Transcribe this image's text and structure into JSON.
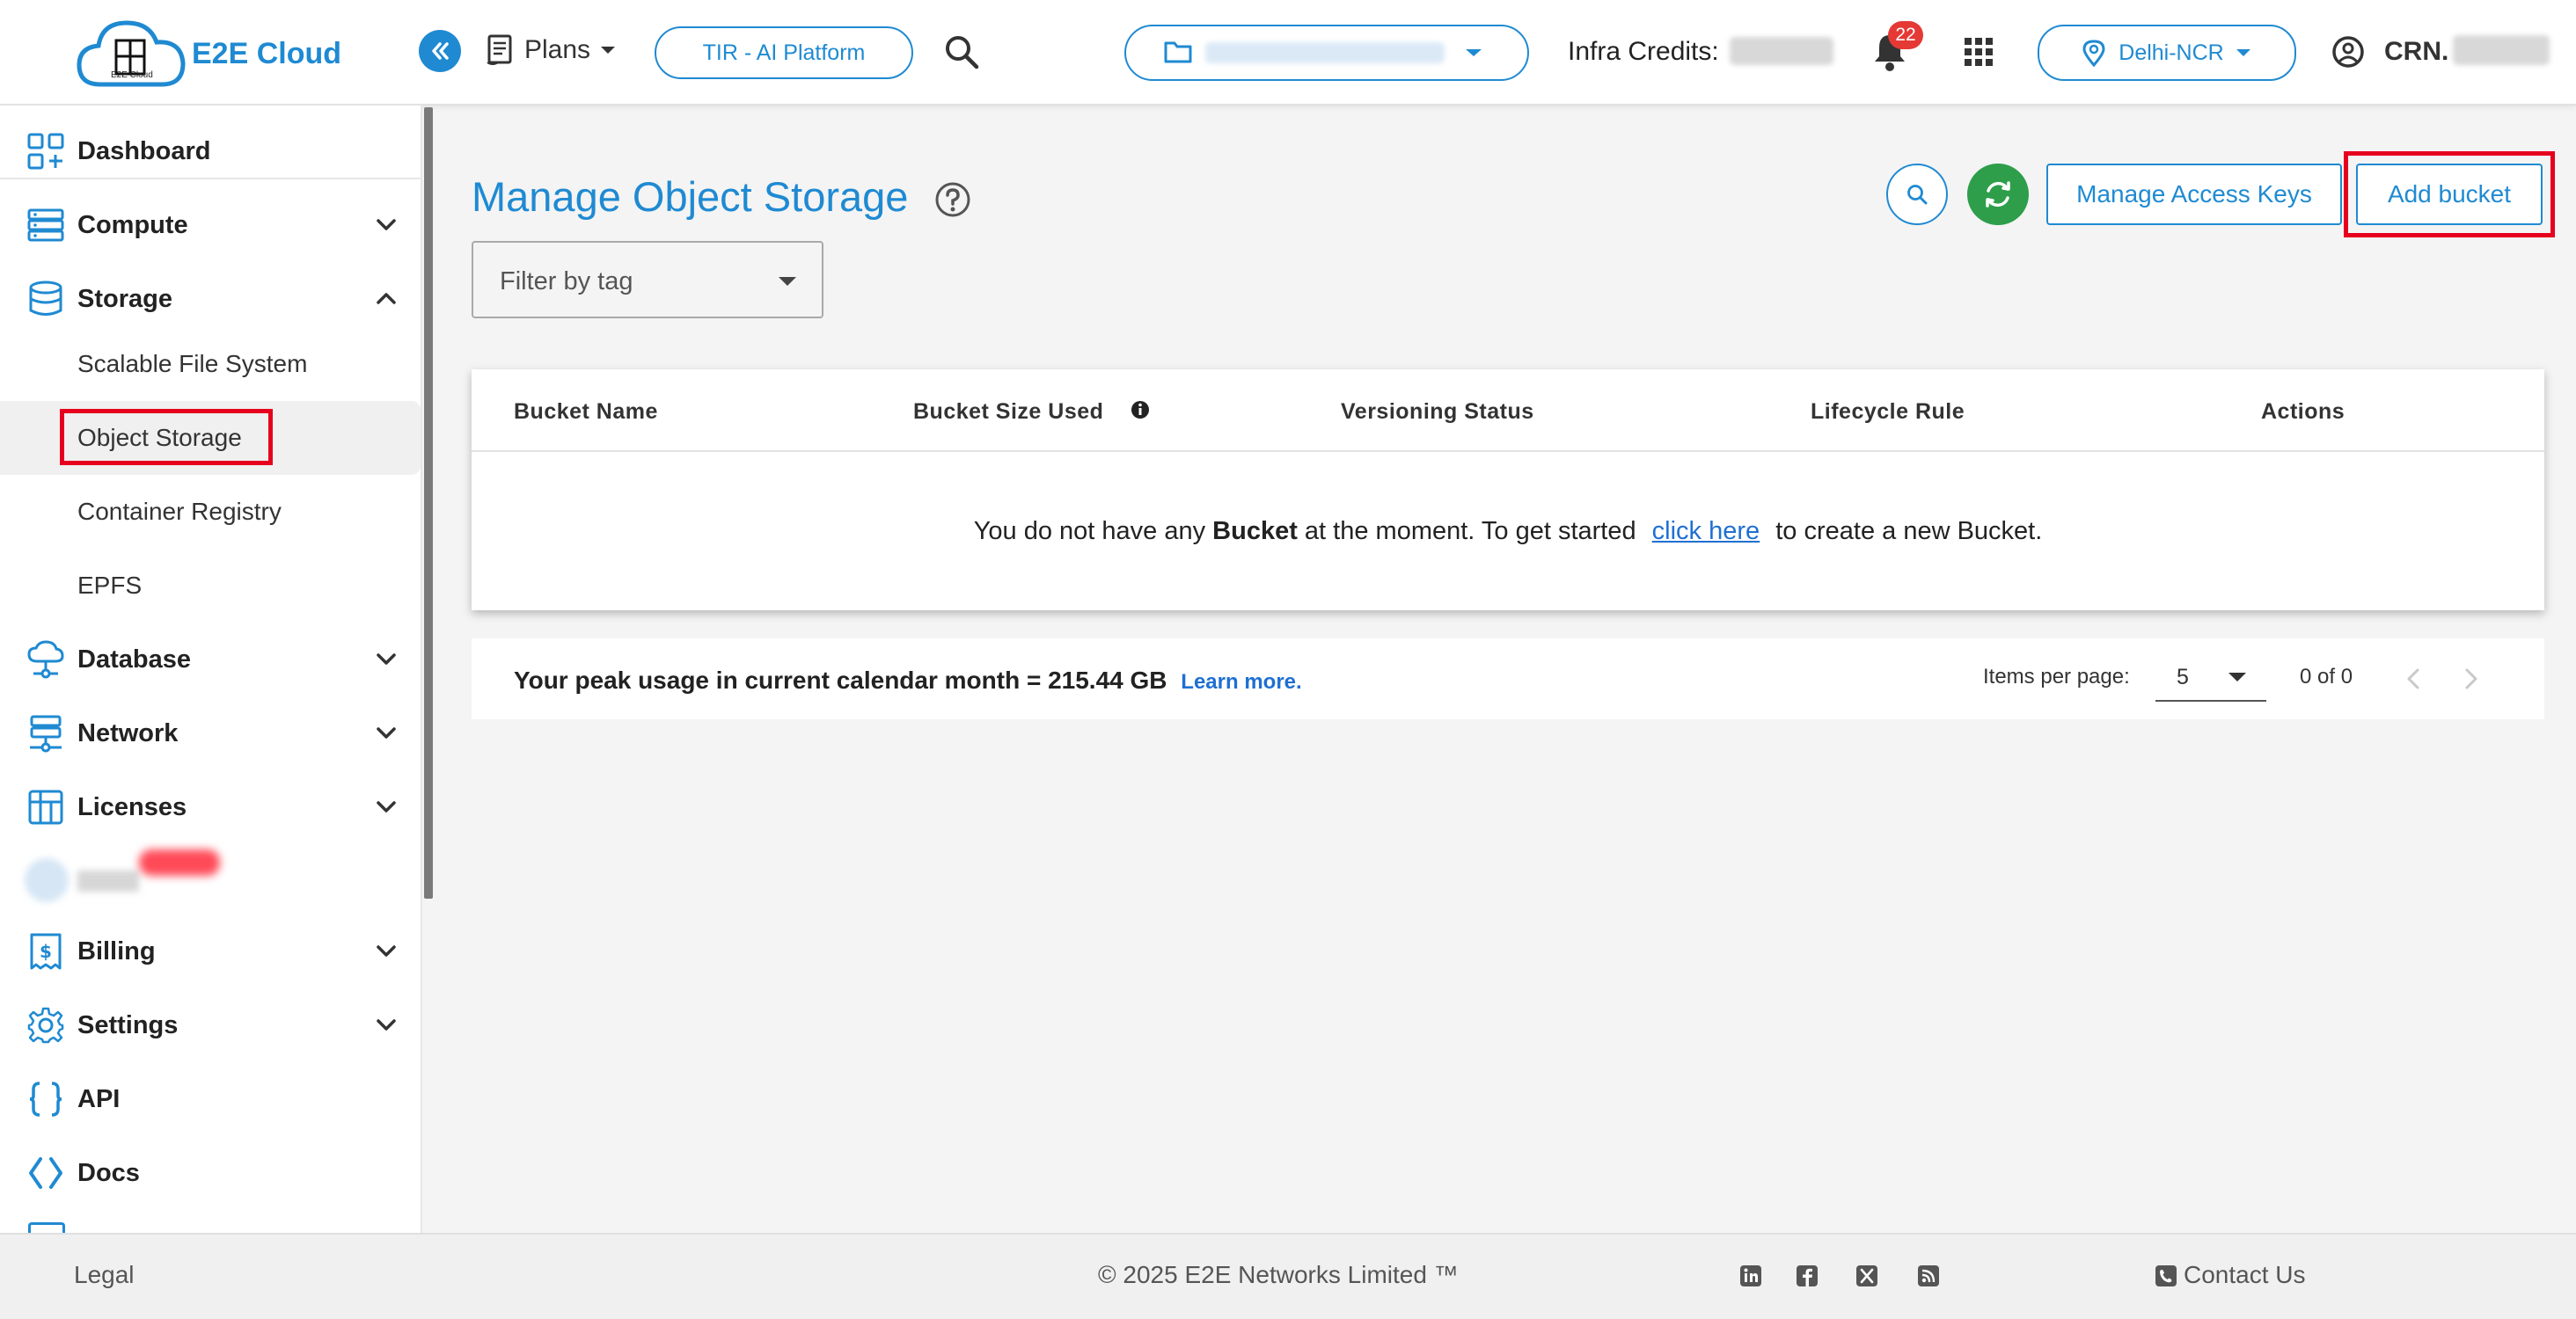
{
  "header": {
    "logo_text": "E2E Cloud",
    "logo_caption": "E2E Cloud",
    "plans_label": "Plans",
    "tir_button": "TIR - AI Platform",
    "infra_credits_label": "Infra Credits:",
    "notification_count": "22",
    "region_label": "Delhi-NCR",
    "crn_label": "CRN."
  },
  "sidebar": {
    "items": [
      {
        "label": "Dashboard"
      },
      {
        "label": "Compute"
      },
      {
        "label": "Storage"
      },
      {
        "label": "Database"
      },
      {
        "label": "Network"
      },
      {
        "label": "Licenses"
      },
      {
        "label": "Billing"
      },
      {
        "label": "Settings"
      },
      {
        "label": "API"
      },
      {
        "label": "Docs"
      }
    ],
    "storage_sub": [
      {
        "label": "Scalable File System"
      },
      {
        "label": "Object Storage"
      },
      {
        "label": "Container Registry"
      },
      {
        "label": "EPFS"
      }
    ]
  },
  "main": {
    "title": "Manage Object Storage",
    "manage_keys_button": "Manage Access Keys",
    "add_bucket_button": "Add bucket",
    "filter_placeholder": "Filter by tag",
    "table": {
      "columns": [
        "Bucket Name",
        "Bucket Size Used",
        "Versioning Status",
        "Lifecycle Rule",
        "Actions"
      ],
      "empty_prefix": "You do not have any",
      "empty_bold": "Bucket",
      "empty_mid": "at the moment. To get started",
      "empty_link": "click here",
      "empty_suffix": "to create a new Bucket."
    },
    "usage_text": "Your peak usage in current calendar month = 215.44 GB",
    "learn_more": "Learn more.",
    "items_per_page_label": "Items per page:",
    "items_per_page_value": "5",
    "page_count": "0 of 0"
  },
  "footer": {
    "legal": "Legal",
    "copyright": "© 2025 E2E Networks Limited ™",
    "contact": "Contact Us"
  },
  "colors": {
    "accent": "#1f8ad2",
    "highlight": "#e6001e",
    "refresh": "#2e9e4a",
    "badge": "#e53935"
  },
  "icons": [
    "cloud-logo-icon",
    "double-chevron-left-icon",
    "plans-icon",
    "search-icon",
    "folder-icon",
    "bell-icon",
    "apps-grid-icon",
    "location-pin-icon",
    "user-circle-icon",
    "dashboard-icon",
    "compute-icon",
    "storage-icon",
    "database-icon",
    "network-icon",
    "licenses-icon",
    "billing-icon",
    "settings-gear-icon",
    "api-braces-icon",
    "docs-code-icon",
    "help-icon",
    "refresh-icon",
    "info-icon",
    "linkedin-icon",
    "facebook-icon",
    "x-twitter-icon",
    "rss-icon",
    "phone-icon"
  ]
}
